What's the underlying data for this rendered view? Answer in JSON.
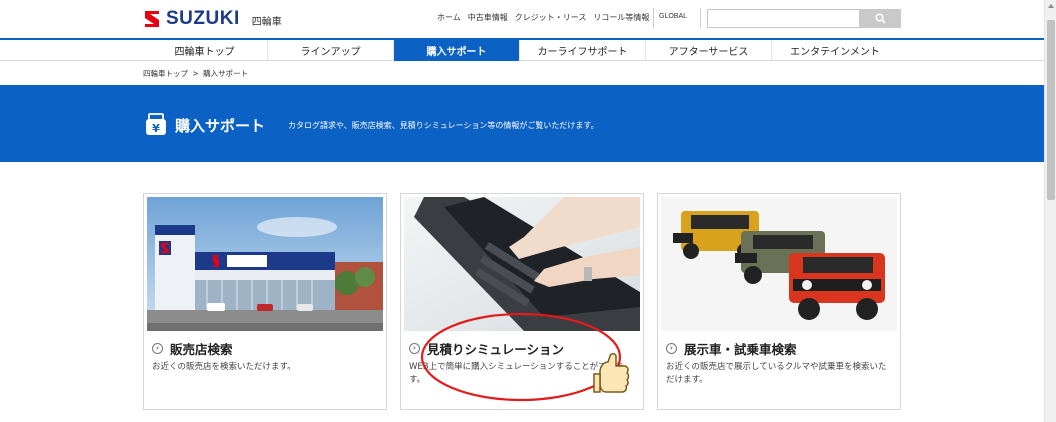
{
  "header": {
    "logo_text": "SUZUKI",
    "logo_sub": "四輪車",
    "utility_links": [
      "ホーム",
      "中古車情報",
      "クレジット・リース",
      "リコール等情報"
    ],
    "global_label": "GLOBAL",
    "search_placeholder": "",
    "search_icon": "search-icon"
  },
  "nav": {
    "items": [
      "四輪車トップ",
      "ラインアップ",
      "購入サポート",
      "カーライフサポート",
      "アフターサービス",
      "エンタテインメント"
    ],
    "active_index": 2
  },
  "breadcrumb": {
    "items": [
      "四輪車トップ",
      ">",
      "購入サポート"
    ]
  },
  "banner": {
    "icon": "yen-wallet-icon",
    "title": "購入サポート",
    "description": "カタログ請求や、販売店検索、見積りシミュレーション等の情報がご覧いただけます。"
  },
  "cards": [
    {
      "title": "販売店検索",
      "description": "お近くの販売店を検索いただけます。",
      "image": "dealership-building-photo"
    },
    {
      "title": "見積りシミュレーション",
      "description": "WEB上で簡単に購入シミュレーションすることができます。",
      "image": "laptop-typing-photo"
    },
    {
      "title": "展示車・試乗車検索",
      "description": "お近くの販売店で展示しているクルマや試乗車を検索いただけます。",
      "image": "three-suvs-photo"
    }
  ],
  "colors": {
    "brand_blue": "#0b62c4",
    "logo_red": "#e60012",
    "annotation_red": "#e21b1b"
  }
}
